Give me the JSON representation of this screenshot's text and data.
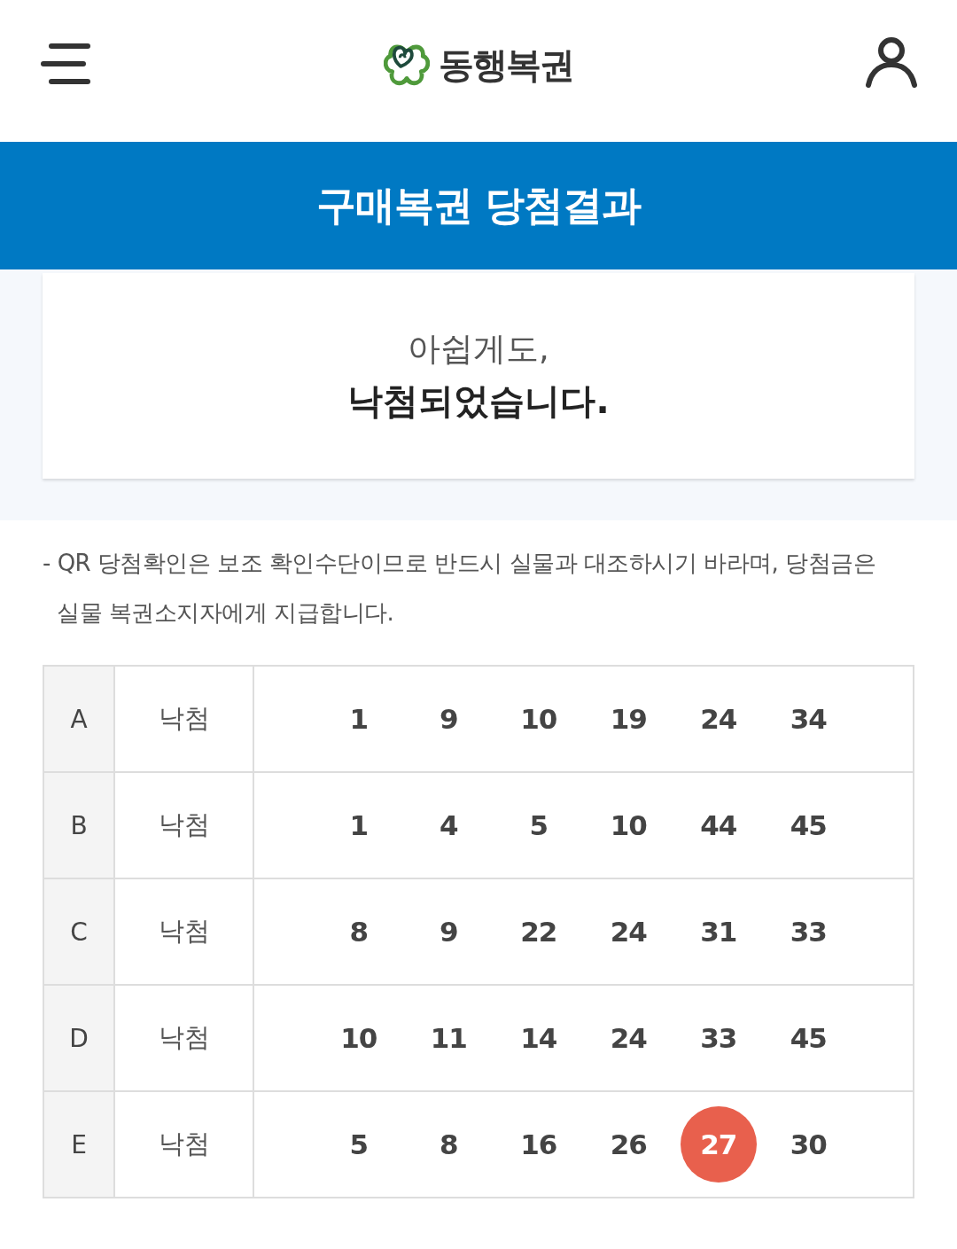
{
  "header": {
    "logo_text": "동행복권"
  },
  "banner": {
    "title": "구매복권 당첨결과"
  },
  "result": {
    "line_1": "아쉽게도,",
    "line_2": "낙첨되었습니다."
  },
  "notice": "- QR 당첨확인은 보조 확인수단이므로 반드시 실물과 대조하시기 바라며, 당첨금은 실물 복권소지자에게 지급합니다.",
  "games": [
    {
      "label": "A",
      "result": "낙첨",
      "numbers": [
        {
          "value": "1",
          "matched": false
        },
        {
          "value": "9",
          "matched": false
        },
        {
          "value": "10",
          "matched": false
        },
        {
          "value": "19",
          "matched": false
        },
        {
          "value": "24",
          "matched": false
        },
        {
          "value": "34",
          "matched": false
        }
      ]
    },
    {
      "label": "B",
      "result": "낙첨",
      "numbers": [
        {
          "value": "1",
          "matched": false
        },
        {
          "value": "4",
          "matched": false
        },
        {
          "value": "5",
          "matched": false
        },
        {
          "value": "10",
          "matched": false
        },
        {
          "value": "44",
          "matched": false
        },
        {
          "value": "45",
          "matched": false
        }
      ]
    },
    {
      "label": "C",
      "result": "낙첨",
      "numbers": [
        {
          "value": "8",
          "matched": false
        },
        {
          "value": "9",
          "matched": false
        },
        {
          "value": "22",
          "matched": false
        },
        {
          "value": "24",
          "matched": false
        },
        {
          "value": "31",
          "matched": false
        },
        {
          "value": "33",
          "matched": false
        }
      ]
    },
    {
      "label": "D",
      "result": "낙첨",
      "numbers": [
        {
          "value": "10",
          "matched": false
        },
        {
          "value": "11",
          "matched": false
        },
        {
          "value": "14",
          "matched": false
        },
        {
          "value": "24",
          "matched": false
        },
        {
          "value": "33",
          "matched": false
        },
        {
          "value": "45",
          "matched": false
        }
      ]
    },
    {
      "label": "E",
      "result": "낙첨",
      "numbers": [
        {
          "value": "5",
          "matched": false
        },
        {
          "value": "8",
          "matched": false
        },
        {
          "value": "16",
          "matched": false
        },
        {
          "value": "26",
          "matched": false
        },
        {
          "value": "27",
          "matched": true
        },
        {
          "value": "30",
          "matched": false
        }
      ]
    }
  ]
}
